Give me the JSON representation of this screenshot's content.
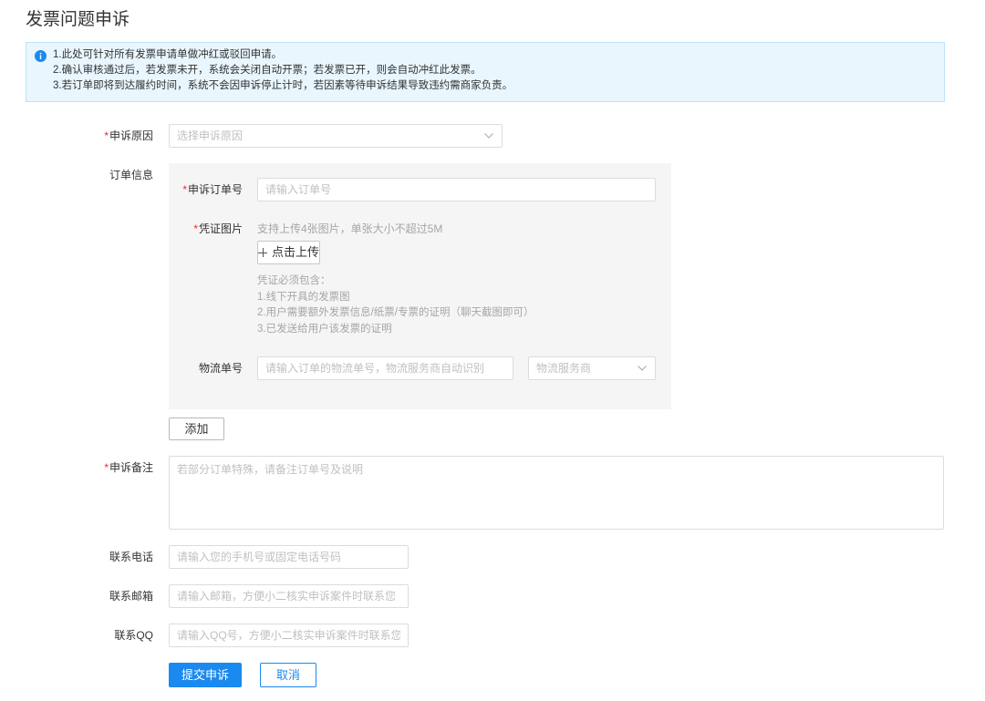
{
  "page": {
    "title": "发票问题申诉"
  },
  "notice": {
    "lines": [
      "1.此处可针对所有发票申请单做冲红或驳回申请。",
      "2.确认审核通过后，若发票未开，系统会关闭自动开票；若发票已开，则会自动冲红此发票。",
      "3.若订单即将到达履约时间，系统不会因申诉停止计时，若因素等待申诉结果导致违约需商家负责。"
    ]
  },
  "form": {
    "required_mark": "*",
    "reason": {
      "label": "申诉原因",
      "placeholder": "选择申诉原因"
    },
    "order_info": {
      "label": "订单信息",
      "order_no": {
        "label": "申诉订单号",
        "placeholder": "请输入订单号"
      },
      "evidence": {
        "label": "凭证图片",
        "hint": "支持上传4张图片，单张大小不超过5M",
        "upload_label": "点击上传",
        "requirements_title": "凭证必须包含：",
        "requirements": [
          "1.线下开具的发票图",
          "2.用户需要额外发票信息/纸票/专票的证明（聊天截图即可）",
          "3.已发送给用户该发票的证明"
        ]
      },
      "logistics": {
        "label": "物流单号",
        "placeholder": "请输入订单的物流单号，物流服务商自动识别",
        "carrier_placeholder": "物流服务商"
      }
    },
    "add_label": "添加",
    "remark": {
      "label": "申诉备注",
      "placeholder": "若部分订单特殊，请备注订单号及说明"
    },
    "phone": {
      "label": "联系电话",
      "placeholder": "请输入您的手机号或固定电话号码"
    },
    "email": {
      "label": "联系邮箱",
      "placeholder": "请输入邮箱，方便小二核实申诉案件时联系您"
    },
    "qq": {
      "label": "联系QQ",
      "placeholder": "请输入QQ号，方便小二核实申诉案件时联系您"
    },
    "submit_label": "提交申诉",
    "cancel_label": "取消"
  },
  "icons": {
    "notice": "info-icon",
    "select_arrow": "chevron-down-icon",
    "upload": "plus-icon"
  },
  "colors": {
    "accent": "#1a89f0",
    "required": "#f5222d",
    "notice_bg": "#e9f6fe",
    "panel_bg": "#f5f5f5"
  }
}
